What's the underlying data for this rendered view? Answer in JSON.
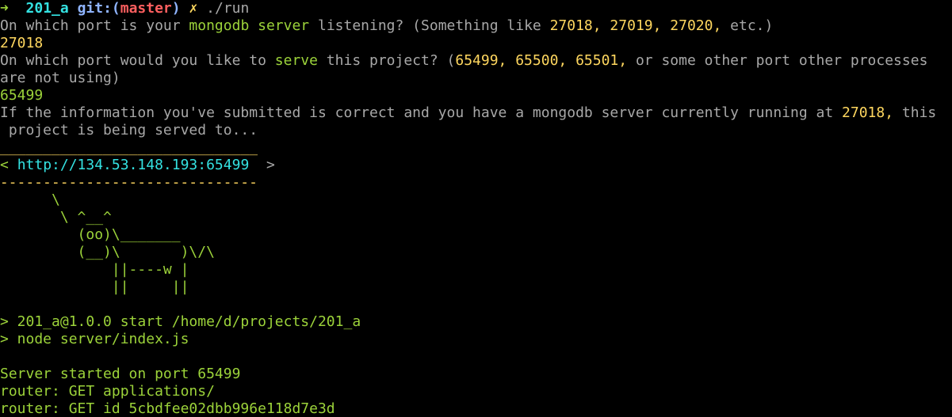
{
  "prompt": {
    "arrow": "➜",
    "dir": "201_a",
    "git_prefix": "git:(",
    "branch": "master",
    "git_suffix": ")",
    "dirty": "✗",
    "command": "./run"
  },
  "q1": {
    "p1": "On which port is your ",
    "hl1": "mongodb server",
    "p2": " listening? (Something like ",
    "ports": "27018, 27019, 27020,",
    "p3": " etc.)"
  },
  "a1": "27018",
  "q2": {
    "p1": "On which port would you like to ",
    "hl1": "serve",
    "p2": " this project? (",
    "ports": "65499, 65500, 65501,",
    "p3": " or some other port other processes",
    "wrap": "are not using)"
  },
  "a2": "65499",
  "info": {
    "p1": "If the information you've submitted is correct and you have a mongodb server currently running at ",
    "port": "27018,",
    "p2": " this",
    "wrap": " project is being served to..."
  },
  "cowsay": {
    "top": " ______________________________",
    "open": "< ",
    "url": "http://134.53.148.193:65499",
    "close": "  >",
    "bottom": " ------------------------------",
    "cow1": "      \\",
    "cow2": "       \\ ^__^",
    "cow3": "         (oo)\\_______",
    "cow4": "         (__)\\       )\\/\\",
    "cow5": "             ||----w |",
    "cow6": "             ||     ||"
  },
  "npm": {
    "line1": "> 201_a@1.0.0 start /home/d/projects/201_a",
    "line2": "> node server/index.js"
  },
  "log": {
    "line1": "Server started on port 65499",
    "line2": "router: GET applications/",
    "line3": "router: GET id 5cbdfee02dbb996e118d7e3d"
  }
}
